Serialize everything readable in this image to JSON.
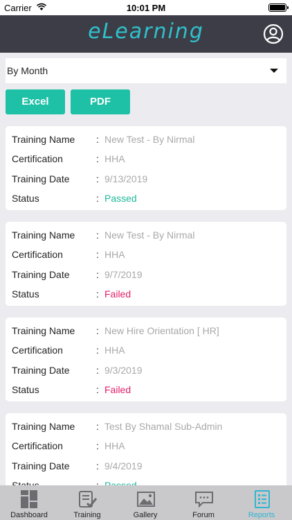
{
  "status_bar": {
    "carrier": "Carrier",
    "time": "10:01 PM"
  },
  "header": {
    "logo_text": "eLearning"
  },
  "filter": {
    "selected": "By Month"
  },
  "actions": {
    "excel_label": "Excel",
    "pdf_label": "PDF"
  },
  "labels": {
    "training_name": "Training Name",
    "certification": "Certification",
    "training_date": "Training Date",
    "status": "Status",
    "separator": ":"
  },
  "records": [
    {
      "training_name": "New Test - By Nirmal",
      "certification": "HHA",
      "training_date": "9/13/2019",
      "status": "Passed"
    },
    {
      "training_name": "New Test - By Nirmal",
      "certification": "HHA",
      "training_date": "9/7/2019",
      "status": "Failed"
    },
    {
      "training_name": "New Hire Orientation [ HR]",
      "certification": "HHA",
      "training_date": "9/3/2019",
      "status": "Failed"
    },
    {
      "training_name": "Test By Shamal Sub-Admin",
      "certification": "HHA",
      "training_date": "9/4/2019",
      "status": "Passed"
    }
  ],
  "tabs": [
    {
      "label": "Dashboard",
      "icon": "dashboard-icon"
    },
    {
      "label": "Training",
      "icon": "training-icon"
    },
    {
      "label": "Gallery",
      "icon": "gallery-icon"
    },
    {
      "label": "Forum",
      "icon": "forum-icon"
    },
    {
      "label": "Reports",
      "icon": "reports-icon"
    }
  ],
  "colors": {
    "accent": "#1ec0a6",
    "passed": "#1fb89c",
    "failed": "#e0206a",
    "navbar": "#3d3d47",
    "logo": "#2fc1cc",
    "active_tab": "#2fb5cf"
  }
}
